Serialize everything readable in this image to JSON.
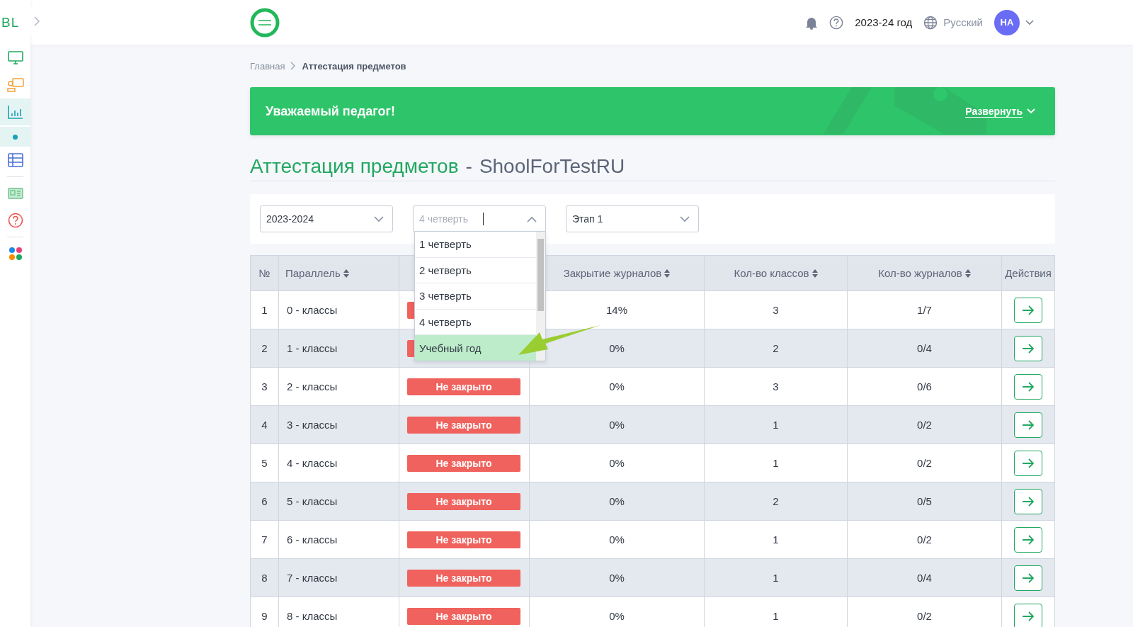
{
  "sidebar": {
    "logo": "BL",
    "items": [
      {
        "kind": "monitor",
        "selected": false
      },
      {
        "kind": "teacher",
        "selected": false
      },
      {
        "kind": "chart",
        "selected": true
      },
      {
        "kind": "dot",
        "selected": true
      },
      {
        "kind": "table",
        "selected": false
      },
      {
        "kind": "divider"
      },
      {
        "kind": "card",
        "selected": false
      },
      {
        "kind": "help",
        "selected": false
      },
      {
        "kind": "divider"
      },
      {
        "kind": "apps",
        "selected": false
      }
    ]
  },
  "header": {
    "year": "2023-24 год",
    "language": "Русский",
    "avatar": "НА"
  },
  "breadcrumbs": [
    {
      "label": "Главная",
      "current": false
    },
    {
      "label": "Аттестация предметов",
      "current": true
    }
  ],
  "banner": {
    "title": "Уважаемый педагог!",
    "action": "Развернуть"
  },
  "page_title": {
    "main": "Аттестация предметов",
    "separator": "-",
    "school": "ShoolForTestRU"
  },
  "filters": [
    {
      "kind": "select",
      "value": "2023-2024",
      "open": false
    },
    {
      "kind": "select",
      "placeholder": "4 четверть",
      "open": true,
      "options": [
        {
          "label": "1 четверть",
          "selected": false
        },
        {
          "label": "2 четверть",
          "selected": false
        },
        {
          "label": "3 четверть",
          "selected": false
        },
        {
          "label": "4 четверть",
          "selected": false
        },
        {
          "label": "Учебный год",
          "selected": true
        }
      ]
    },
    {
      "kind": "select",
      "value": "Этап 1",
      "open": false
    }
  ],
  "table": {
    "columns": [
      {
        "label": "№",
        "sortable": false
      },
      {
        "label": "Параллель",
        "sortable": true
      },
      {},
      {
        "label": "Закрытие журналов",
        "sortable": true
      },
      {
        "label": "Кол-во классов",
        "sortable": true
      },
      {
        "label": "Кол-во журналов",
        "sortable": true
      },
      {
        "label": "Действия",
        "sortable": false
      }
    ],
    "rows": [
      {
        "n": "1",
        "parallel": "0 - классы",
        "status": {
          "closed": false
        },
        "closing": "14%",
        "classes": "3",
        "journals": "1/7"
      },
      {
        "n": "2",
        "parallel": "1 - классы",
        "status": {
          "closed": false
        },
        "closing": "0%",
        "classes": "2",
        "journals": "0/4"
      },
      {
        "n": "3",
        "parallel": "2 - классы",
        "status": {
          "closed": false,
          "label": "Не закрыто"
        },
        "closing": "0%",
        "classes": "3",
        "journals": "0/6"
      },
      {
        "n": "4",
        "parallel": "3 - классы",
        "status": {
          "closed": false,
          "label": "Не закрыто"
        },
        "closing": "0%",
        "classes": "1",
        "journals": "0/2"
      },
      {
        "n": "5",
        "parallel": "4 - классы",
        "status": {
          "closed": false,
          "label": "Не закрыто"
        },
        "closing": "0%",
        "classes": "1",
        "journals": "0/2"
      },
      {
        "n": "6",
        "parallel": "5 - классы",
        "status": {
          "closed": false,
          "label": "Не закрыто"
        },
        "closing": "0%",
        "classes": "2",
        "journals": "0/5"
      },
      {
        "n": "7",
        "parallel": "6 - классы",
        "status": {
          "closed": false,
          "label": "Не закрыто"
        },
        "closing": "0%",
        "classes": "1",
        "journals": "0/2"
      },
      {
        "n": "8",
        "parallel": "7 - классы",
        "status": {
          "closed": false,
          "label": "Не закрыто"
        },
        "closing": "0%",
        "classes": "1",
        "journals": "0/4"
      },
      {
        "n": "9",
        "parallel": "8 - классы",
        "status": {
          "closed": false,
          "label": "Не закрыто"
        },
        "closing": "0%",
        "classes": "1",
        "journals": "0/2"
      }
    ]
  }
}
